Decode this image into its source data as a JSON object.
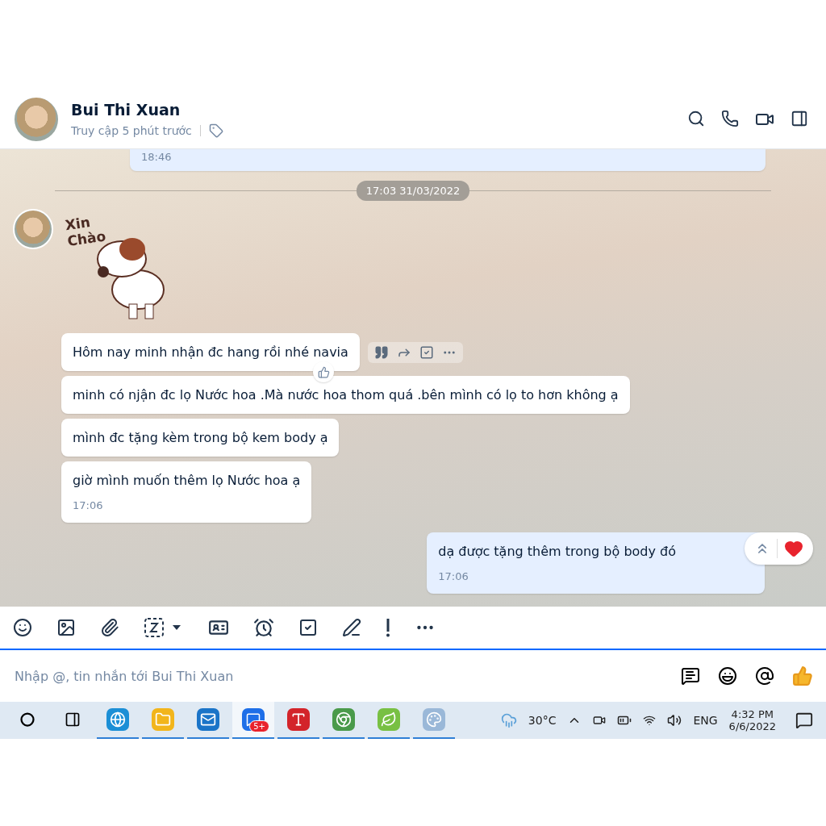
{
  "header": {
    "name": "Bui Thi Xuan",
    "status": "Truy cập 5 phút trước"
  },
  "chat": {
    "previous_message": {
      "time": "18:46"
    },
    "date_divider": "17:03 31/03/2022",
    "sticker_text": "Xin Chào",
    "incoming": [
      {
        "text": "Hôm nay minh nhận đc hang rồi nhé navia",
        "hovered": true
      },
      {
        "text": "minh có njận đc lọ Nước hoa .Mà nước hoa thom quá .bên mình có lọ to hơn không ạ",
        "hovered": false
      },
      {
        "text": "mình đc tặng kèm trong bộ kem body ạ",
        "hovered": false
      },
      {
        "text": "giờ mình muốn thêm lọ Nước hoa ạ",
        "hovered": false,
        "time": "17:06"
      }
    ],
    "outgoing": {
      "text": "dạ được tặng thêm trong bộ body đó",
      "time": "17:06"
    }
  },
  "composer": {
    "placeholder": "Nhập @, tin nhắn tới Bui Thi Xuan"
  },
  "taskbar": {
    "apps": [
      {
        "kind": "edge",
        "running": true,
        "selected": false
      },
      {
        "kind": "explorer",
        "running": true,
        "selected": false
      },
      {
        "kind": "mail",
        "running": true,
        "selected": false
      },
      {
        "kind": "zalo",
        "running": true,
        "selected": true,
        "badge": "5+"
      },
      {
        "kind": "vnote",
        "running": true,
        "selected": false
      },
      {
        "kind": "chrome",
        "running": true,
        "selected": false
      },
      {
        "kind": "coccoc",
        "running": true,
        "selected": false
      },
      {
        "kind": "paint",
        "running": true,
        "selected": false
      }
    ],
    "temperature": "30°C",
    "language": "ENG",
    "time": "4:32 PM",
    "date": "6/6/2022"
  }
}
